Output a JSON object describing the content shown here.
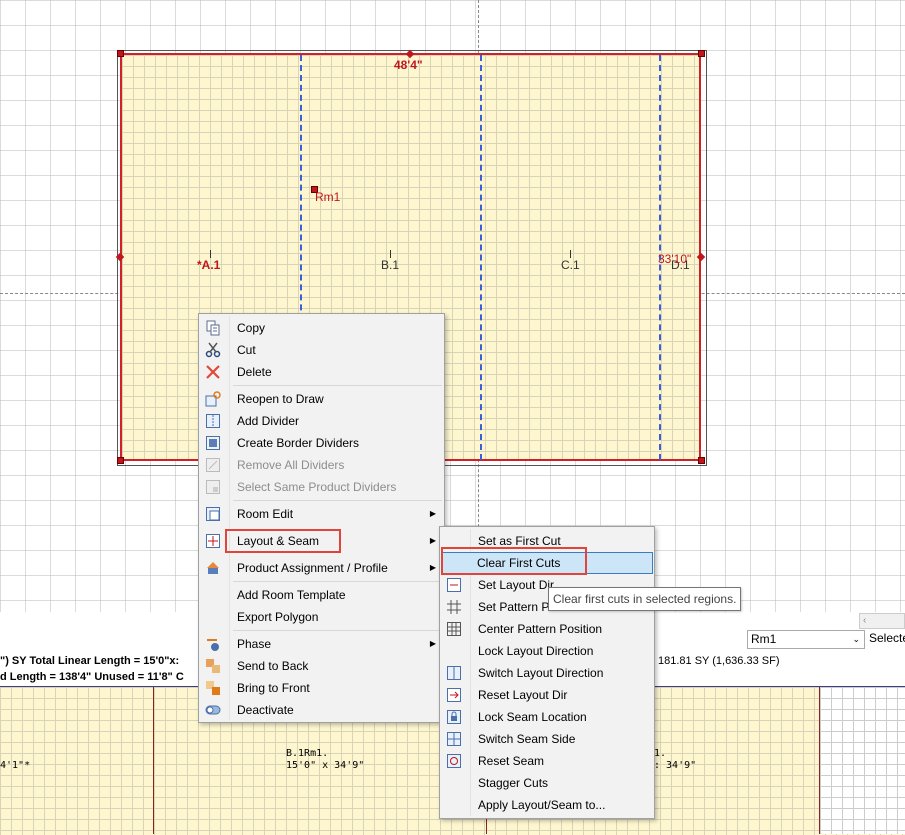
{
  "canvas": {
    "room_name": "Rm1",
    "dim_top": "48'4\"",
    "dim_right": "33'10\"",
    "regions": [
      "*A.1",
      "B.1",
      "C.1",
      "D.1"
    ]
  },
  "status": {
    "line1_left": "\") SY  Total Linear Length = 15'0\"x:",
    "line2_left": "d Length = 138'4\"  Unused = 11'8\"  C",
    "line1_right": "181.81 SY (1,636.33 SF)",
    "room_select": "Rm1",
    "select_label": "Selecte"
  },
  "strip": {
    "label_a": "4'1\"*",
    "label_b_name": "B.1Rm1.",
    "label_b_size": "15'0\" x 34'9\"",
    "label_c_name": "1.",
    "label_c_size": ": 34'9\""
  },
  "context_menu": {
    "items": [
      {
        "label": "Copy",
        "icon": "copy-icon"
      },
      {
        "label": "Cut",
        "icon": "scissors-icon"
      },
      {
        "label": "Delete",
        "icon": "delete-x-icon"
      },
      {
        "label": "Reopen to Draw",
        "icon": "reopen-draw-icon"
      },
      {
        "label": "Add Divider",
        "icon": "add-divider-icon"
      },
      {
        "label": "Create Border Dividers",
        "icon": "border-dividers-icon"
      },
      {
        "label": "Remove All Dividers",
        "icon": "remove-dividers-icon",
        "disabled": true
      },
      {
        "label": "Select Same Product Dividers",
        "icon": "select-dividers-icon",
        "disabled": true
      },
      {
        "label": "Room Edit",
        "icon": "room-edit-icon"
      },
      {
        "label": "Layout & Seam",
        "icon": "layout-seam-icon"
      },
      {
        "label": "Product Assignment / Profile",
        "icon": "product-assignment-icon"
      },
      {
        "label": "Add Room Template"
      },
      {
        "label": "Export Polygon"
      },
      {
        "label": "Phase",
        "icon": "phase-icon"
      },
      {
        "label": "Send to Back",
        "icon": "send-back-icon"
      },
      {
        "label": "Bring to Front",
        "icon": "bring-front-icon"
      },
      {
        "label": "Deactivate",
        "icon": "toggle-icon"
      }
    ]
  },
  "submenu": {
    "items": [
      {
        "label": "Set as First Cut"
      },
      {
        "label": "Clear First Cuts"
      },
      {
        "label": "Set Layout Dir",
        "icon": "layout-dir-icon"
      },
      {
        "label": "Set Pattern Po",
        "icon": "pattern-icon"
      },
      {
        "label": "Center Pattern Position",
        "icon": "center-pattern-icon"
      },
      {
        "label": "Lock Layout Direction"
      },
      {
        "label": "Switch Layout Direction",
        "icon": "switch-layout-icon"
      },
      {
        "label": "Reset Layout Dir",
        "icon": "reset-layout-icon"
      },
      {
        "label": "Lock Seam Location",
        "icon": "lock-seam-icon"
      },
      {
        "label": "Switch Seam Side",
        "icon": "switch-seam-icon"
      },
      {
        "label": "Reset Seam",
        "icon": "reset-seam-icon"
      },
      {
        "label": "Stagger Cuts"
      },
      {
        "label": "Apply Layout/Seam to..."
      }
    ]
  },
  "tooltip": "Clear first cuts in selected regions.",
  "colors": {
    "accent_red": "#d32027",
    "seam_blue": "#3a5fd9",
    "highlight": "#cde6f7"
  }
}
